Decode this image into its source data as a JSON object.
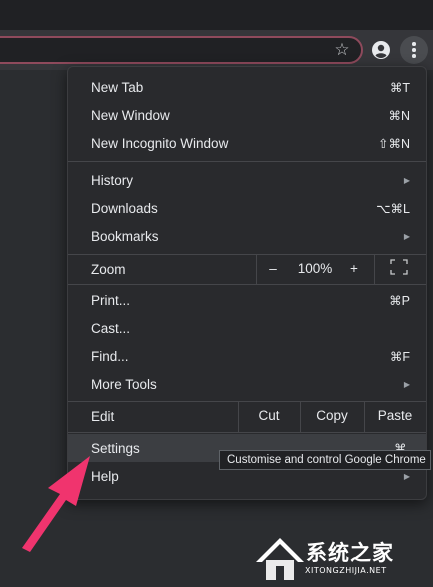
{
  "browser": {
    "star_glyph": "☆"
  },
  "menu": {
    "items": [
      {
        "label": "New Tab",
        "shortcut": "⌘T"
      },
      {
        "label": "New Window",
        "shortcut": "⌘N"
      },
      {
        "label": "New Incognito Window",
        "shortcut": "⇧⌘N"
      },
      {
        "label": "History",
        "shortcut": "▶"
      },
      {
        "label": "Downloads",
        "shortcut": "⌥⌘L"
      },
      {
        "label": "Bookmarks",
        "shortcut": "▶"
      },
      {
        "label": "Print...",
        "shortcut": "⌘P"
      },
      {
        "label": "Cast..."
      },
      {
        "label": "Find...",
        "shortcut": "⌘F"
      },
      {
        "label": "More Tools",
        "shortcut": "▶"
      },
      {
        "label": "Settings",
        "shortcut": "⌘,"
      },
      {
        "label": "Help",
        "shortcut": "▶"
      }
    ],
    "zoom": {
      "label": "Zoom",
      "minus": "–",
      "value": "100%",
      "plus": "+"
    },
    "edit": {
      "label": "Edit",
      "cut": "Cut",
      "copy": "Copy",
      "paste": "Paste"
    }
  },
  "tooltip": "Customise and control Google Chrome",
  "watermark": {
    "title": "系统之家",
    "subtitle": "XITONGZHIJIA.NET"
  },
  "colors": {
    "menu_bg": "#292a2d",
    "hover_bg": "#3c3e42",
    "annotation_arrow": "#f0346e"
  }
}
